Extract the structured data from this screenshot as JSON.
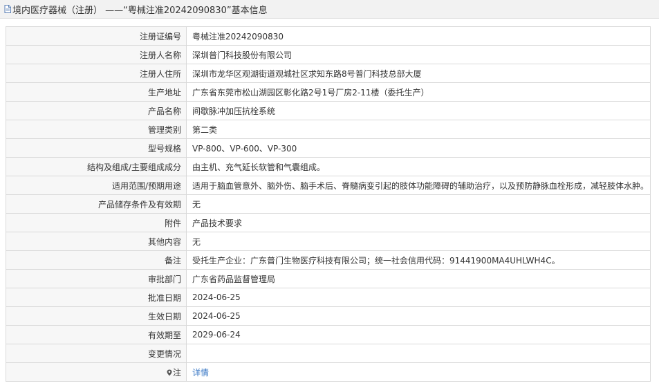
{
  "header": {
    "title": "境内医疗器械（注册） ——“粤械注准20242090830”基本信息"
  },
  "rows": [
    {
      "label": "注册证编号",
      "value": "粤械注准20242090830"
    },
    {
      "label": "注册人名称",
      "value": "深圳普门科技股份有限公司"
    },
    {
      "label": "注册人住所",
      "value": "深圳市龙华区观湖街道观城社区求知东路8号普门科技总部大厦"
    },
    {
      "label": "生产地址",
      "value": "广东省东莞市松山湖园区彰化路2号1号厂房2-11楼（委托生产）"
    },
    {
      "label": "产品名称",
      "value": "间歇脉冲加压抗栓系统"
    },
    {
      "label": "管理类别",
      "value": "第二类"
    },
    {
      "label": "型号规格",
      "value": "VP-800、VP-600、VP-300"
    },
    {
      "label": "结构及组成/主要组成成分",
      "value": "由主机、充气延长软管和气囊组成。"
    },
    {
      "label": "适用范围/预期用途",
      "value": "适用于脑血管意外、脑外伤、脑手术后、脊髓病变引起的肢体功能障碍的辅助治疗，以及预防静脉血栓形成，减轻肢体水肿。"
    },
    {
      "label": "产品储存条件及有效期",
      "value": "无"
    },
    {
      "label": "附件",
      "value": "产品技术要求"
    },
    {
      "label": "其他内容",
      "value": "无"
    },
    {
      "label": "备注",
      "value": "受托生产企业：广东普门生物医疗科技有限公司；统一社会信用代码：91441900MA4UHLWH4C。"
    },
    {
      "label": "审批部门",
      "value": "广东省药品监督管理局"
    },
    {
      "label": "批准日期",
      "value": "2024-06-25"
    },
    {
      "label": "生效日期",
      "value": "2024-06-25"
    },
    {
      "label": "有效期至",
      "value": "2029-06-24"
    },
    {
      "label": "变更情况",
      "value": ""
    }
  ],
  "note_row": {
    "label": "注",
    "link_text": "详情"
  }
}
